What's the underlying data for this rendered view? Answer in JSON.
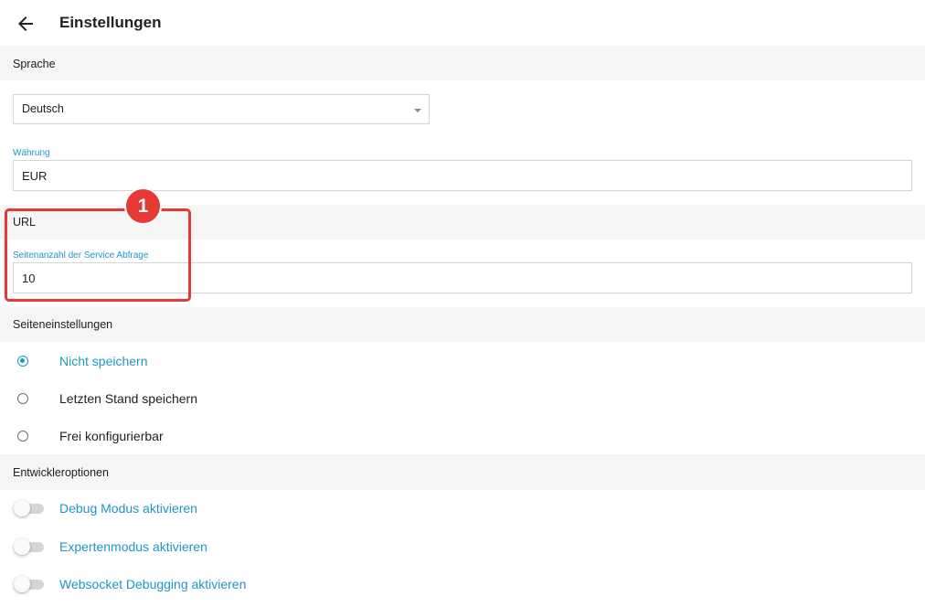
{
  "header": {
    "title": "Einstellungen",
    "back_icon": "arrow-left-icon"
  },
  "sections": {
    "language": "Sprache",
    "url": "URL",
    "page_settings": "Seiteneinstellungen",
    "developer": "Entwickleroptionen"
  },
  "language_select": {
    "selected": "Deutsch"
  },
  "currency_field": {
    "label": "Währung",
    "value": "EUR"
  },
  "page_count_field": {
    "label": "Seitenanzahl der Service Abfrage",
    "value": "10"
  },
  "page_settings_options": [
    {
      "label": "Nicht speichern",
      "checked": true
    },
    {
      "label": "Letzten Stand speichern",
      "checked": false
    },
    {
      "label": "Frei konfigurierbar",
      "checked": false
    }
  ],
  "developer_options": [
    {
      "label": "Debug Modus aktivieren",
      "enabled": false
    },
    {
      "label": "Expertenmodus aktivieren",
      "enabled": false
    },
    {
      "label": "Websocket Debugging aktivieren",
      "enabled": false
    }
  ],
  "annotation": {
    "badge_number": "1"
  },
  "colors": {
    "accent": "#2196c8",
    "annotation": "#e53935",
    "section_bg": "#f5f5f5"
  }
}
